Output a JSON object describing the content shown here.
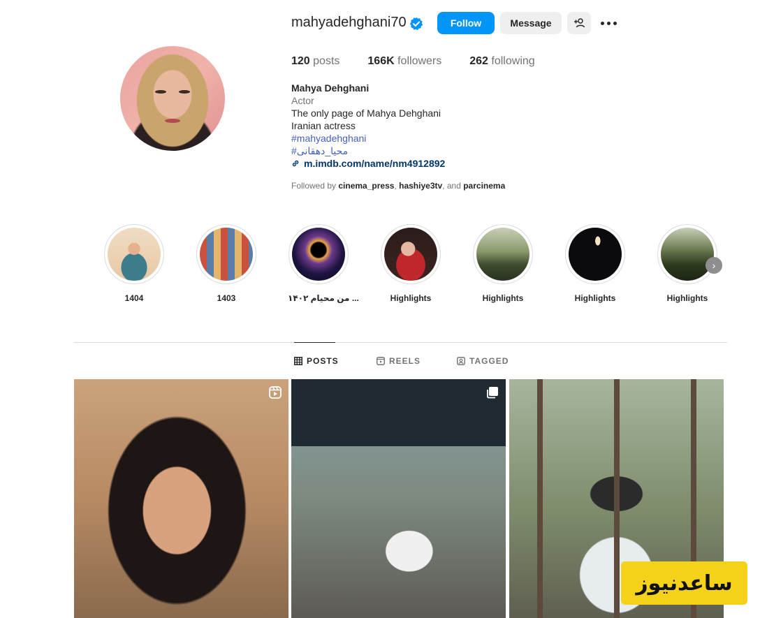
{
  "profile": {
    "username": "mahyadehghani70",
    "verified": true,
    "buttons": {
      "follow": "Follow",
      "message": "Message"
    },
    "stats": {
      "posts_count": "120",
      "posts_label": "posts",
      "followers_count": "166K",
      "followers_label": "followers",
      "following_count": "262",
      "following_label": "following"
    },
    "full_name": "Mahya Dehghani",
    "category": "Actor",
    "bio": [
      "The only page of Mahya Dehghani",
      "Iranian actress"
    ],
    "hashtags": [
      "#mahyadehghani",
      "#محیا_دهقانی"
    ],
    "link": "m.imdb.com/name/nm4912892",
    "followed_by": {
      "prefix": "Followed by",
      "users": [
        "cinema_press",
        "hashiye3tv",
        "parcinema"
      ],
      "sep1": ",",
      "sep2": ", and"
    }
  },
  "highlights": [
    {
      "label": "1404"
    },
    {
      "label": "1403"
    },
    {
      "label": "من محیام ۱۴۰۲ ..."
    },
    {
      "label": "Highlights"
    },
    {
      "label": "Highlights"
    },
    {
      "label": "Highlights"
    },
    {
      "label": "Highlights"
    }
  ],
  "tabs": [
    {
      "label": "POSTS",
      "active": true
    },
    {
      "label": "REELS",
      "active": false
    },
    {
      "label": "TAGGED",
      "active": false
    }
  ],
  "watermark": "ساعدنیوز",
  "colors": {
    "accent": "#0095f6",
    "link": "#00376b",
    "hashtag": "#4460bd"
  }
}
